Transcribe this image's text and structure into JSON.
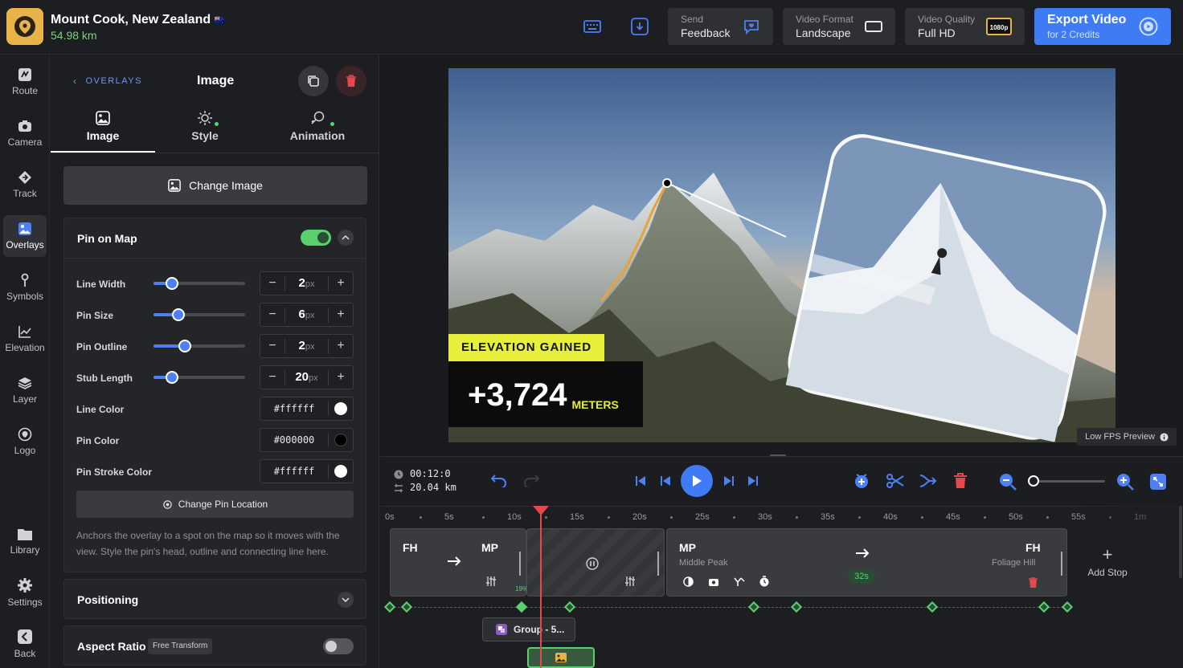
{
  "header": {
    "title": "Mount Cook, New Zealand",
    "flag": "🇳🇿",
    "distance": "54.98 km",
    "feedback": {
      "line1": "Send",
      "line2": "Feedback"
    },
    "format": {
      "line1": "Video Format",
      "line2": "Landscape"
    },
    "quality": {
      "line1": "Video Quality",
      "line2": "Full HD",
      "badge": "1080p"
    },
    "export": {
      "line1": "Export Video",
      "line2": "for 2 Credits"
    }
  },
  "nav": {
    "items": [
      {
        "label": "Route",
        "icon": "route-icon"
      },
      {
        "label": "Camera",
        "icon": "camera-icon"
      },
      {
        "label": "Track",
        "icon": "track-icon"
      },
      {
        "label": "Overlays",
        "icon": "overlays-icon",
        "active": true
      },
      {
        "label": "Symbols",
        "icon": "pin-icon"
      },
      {
        "label": "Elevation",
        "icon": "chart-icon"
      },
      {
        "label": "Layer",
        "icon": "layers-icon"
      },
      {
        "label": "Logo",
        "icon": "logo-icon"
      }
    ],
    "bottom": [
      {
        "label": "Library",
        "icon": "folder-icon"
      },
      {
        "label": "Settings",
        "icon": "gear-icon"
      },
      {
        "label": "Back",
        "icon": "back-icon"
      }
    ]
  },
  "panel": {
    "breadcrumb": "OVERLAYS",
    "title": "Image",
    "tabs": [
      {
        "label": "Image",
        "icon": "image-icon",
        "active": true
      },
      {
        "label": "Style",
        "icon": "sun-icon",
        "dot": true
      },
      {
        "label": "Animation",
        "icon": "animation-icon",
        "dot": true
      }
    ],
    "change_image": "Change Image",
    "pin_on_map": {
      "label": "Pin on Map",
      "enabled": true
    },
    "sliders": [
      {
        "label": "Line Width",
        "value": "2",
        "unit": "px",
        "fraction": 0.2
      },
      {
        "label": "Pin Size",
        "value": "6",
        "unit": "px",
        "fraction": 0.27
      },
      {
        "label": "Pin Outline",
        "value": "2",
        "unit": "px",
        "fraction": 0.34
      },
      {
        "label": "Stub Length",
        "value": "20",
        "unit": "px",
        "fraction": 0.2
      }
    ],
    "colors": [
      {
        "label": "Line Color",
        "hex": "#ffffff",
        "swatch": "#ffffff"
      },
      {
        "label": "Pin Color",
        "hex": "#000000",
        "swatch": "#000000"
      },
      {
        "label": "Pin Stroke Color",
        "hex": "#ffffff",
        "swatch": "#ffffff"
      }
    ],
    "change_pin_location": "Change Pin Location",
    "help_text": "Anchors the overlay to a spot on the map so it moves with the view. Style the pin's head, outline and connecting line here.",
    "positioning": "Positioning",
    "aspect_ratio": {
      "label": "Aspect Ratio",
      "badge": "Free Transform",
      "enabled": false
    }
  },
  "preview": {
    "elevation_label": "ELEVATION GAINED",
    "elevation_value": "+3,724",
    "elevation_unit": "METERS",
    "low_fps": "Low FPS Preview"
  },
  "transport": {
    "time": "00:12:0",
    "distance": "20.04 km",
    "zoom_fraction": 0.05
  },
  "timeline": {
    "ticks": [
      "0s",
      "5s",
      "10s",
      "15s",
      "20s",
      "25s",
      "30s",
      "35s",
      "40s",
      "45s",
      "50s",
      "55s",
      "1m"
    ],
    "segment1": {
      "from": "FH",
      "to": "MP",
      "percent": "19%"
    },
    "segment3": {
      "from": "MP",
      "from_name": "Middle Peak",
      "to": "FH",
      "to_name": "Foliage Hill",
      "duration": "32s"
    },
    "add_stop": "Add Stop",
    "group": "Group - 5..."
  },
  "colors": {
    "accent": "#3e7bf4",
    "green": "#5ad06e",
    "danger": "#e5484d",
    "playhead": "#e5484d"
  }
}
